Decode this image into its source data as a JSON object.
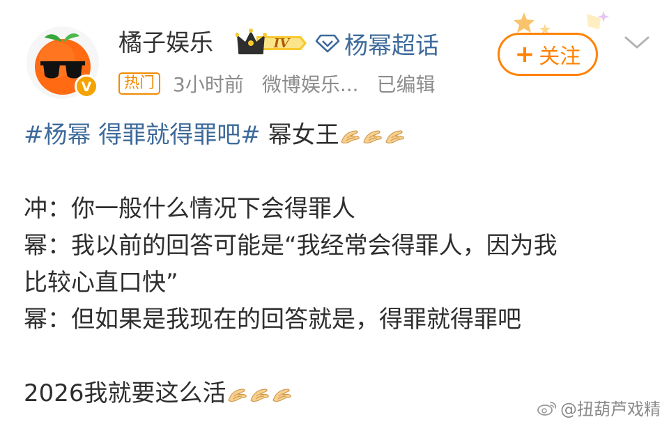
{
  "header": {
    "username": "橘子娱乐",
    "vip_level": "IV",
    "super_topic": "杨幂超话",
    "hot_badge": "热门",
    "time": "3小时前",
    "source": "微博娱乐...",
    "edited": "已编辑",
    "verified_mark": "V"
  },
  "follow": {
    "plus": "+",
    "label": "关注"
  },
  "post": {
    "hashtag": "#杨幂 得罪就得罪吧#",
    "line1_text": " 幂女王",
    "line2": "冲：你一般什么情况下会得罪人",
    "line3": "幂：我以前的回答可能是“我经常会得罪人，因为我",
    "line4": "比较心直口快”",
    "line5": "幂：但如果是我现在的回答就是，得罪就得罪吧",
    "line6_text": "2026我就要这么活"
  },
  "watermark": {
    "text": "@扭葫芦戏精"
  },
  "icons": {
    "emoji": "clap-hands-emoji",
    "gem": "gem-icon",
    "crown": "crown-icon",
    "chevron": "chevron-down-icon"
  },
  "colors": {
    "accent": "#ff8200",
    "link": "#3d6a9a",
    "meta": "#8c8c8c",
    "hot": "#f08b00"
  }
}
